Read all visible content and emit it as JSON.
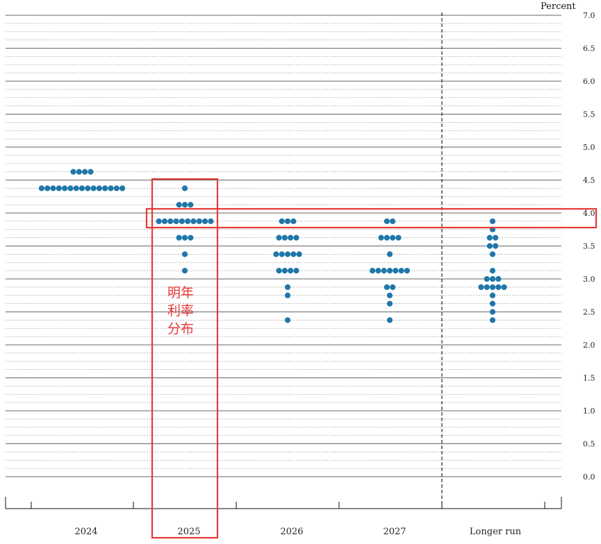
{
  "chart_data": {
    "type": "scatter",
    "ylabel": "Percent",
    "ylim": [
      0,
      7
    ],
    "y_ticks": [
      "0.0",
      "0.5",
      "1.0",
      "1.5",
      "2.0",
      "2.5",
      "3.0",
      "3.5",
      "4.0",
      "4.5",
      "5.0",
      "5.5",
      "6.0",
      "6.5",
      "7.0"
    ],
    "categories": [
      "2024",
      "2025",
      "2026",
      "2027",
      "Longer run"
    ],
    "grid": true,
    "dot_color": "#1f77a8",
    "dots": [
      {
        "category": "2024",
        "rate": 4.625,
        "count": 4
      },
      {
        "category": "2024",
        "rate": 4.375,
        "count": 15
      },
      {
        "category": "2025",
        "rate": 4.375,
        "count": 1
      },
      {
        "category": "2025",
        "rate": 4.125,
        "count": 3
      },
      {
        "category": "2025",
        "rate": 3.875,
        "count": 10
      },
      {
        "category": "2025",
        "rate": 3.625,
        "count": 3
      },
      {
        "category": "2025",
        "rate": 3.375,
        "count": 1
      },
      {
        "category": "2025",
        "rate": 3.125,
        "count": 1
      },
      {
        "category": "2026",
        "rate": 3.875,
        "count": 3
      },
      {
        "category": "2026",
        "rate": 3.625,
        "count": 4
      },
      {
        "category": "2026",
        "rate": 3.375,
        "count": 5
      },
      {
        "category": "2026",
        "rate": 3.125,
        "count": 4
      },
      {
        "category": "2026",
        "rate": 2.875,
        "count": 1
      },
      {
        "category": "2026",
        "rate": 2.75,
        "count": 1
      },
      {
        "category": "2026",
        "rate": 2.375,
        "count": 1
      },
      {
        "category": "2027",
        "rate": 3.875,
        "count": 2
      },
      {
        "category": "2027",
        "rate": 3.625,
        "count": 4
      },
      {
        "category": "2027",
        "rate": 3.375,
        "count": 1
      },
      {
        "category": "2027",
        "rate": 3.125,
        "count": 7
      },
      {
        "category": "2027",
        "rate": 2.875,
        "count": 2
      },
      {
        "category": "2027",
        "rate": 2.75,
        "count": 1
      },
      {
        "category": "2027",
        "rate": 2.625,
        "count": 1
      },
      {
        "category": "2027",
        "rate": 2.375,
        "count": 1
      },
      {
        "category": "Longer run",
        "rate": 3.875,
        "count": 1
      },
      {
        "category": "Longer run",
        "rate": 3.75,
        "count": 1
      },
      {
        "category": "Longer run",
        "rate": 3.625,
        "count": 2
      },
      {
        "category": "Longer run",
        "rate": 3.5,
        "count": 2
      },
      {
        "category": "Longer run",
        "rate": 3.375,
        "count": 1
      },
      {
        "category": "Longer run",
        "rate": 3.125,
        "count": 1
      },
      {
        "category": "Longer run",
        "rate": 3.0,
        "count": 3
      },
      {
        "category": "Longer run",
        "rate": 2.875,
        "count": 5
      },
      {
        "category": "Longer run",
        "rate": 2.75,
        "count": 1
      },
      {
        "category": "Longer run",
        "rate": 2.625,
        "count": 1
      },
      {
        "category": "Longer run",
        "rate": 2.5,
        "count": 1
      },
      {
        "category": "Longer run",
        "rate": 2.375,
        "count": 1
      }
    ],
    "annotations": {
      "color": "#e53935",
      "column_highlight": "2025",
      "row_highlight": 4.0,
      "label_lines": [
        "明年",
        "利率",
        "分布"
      ]
    }
  }
}
